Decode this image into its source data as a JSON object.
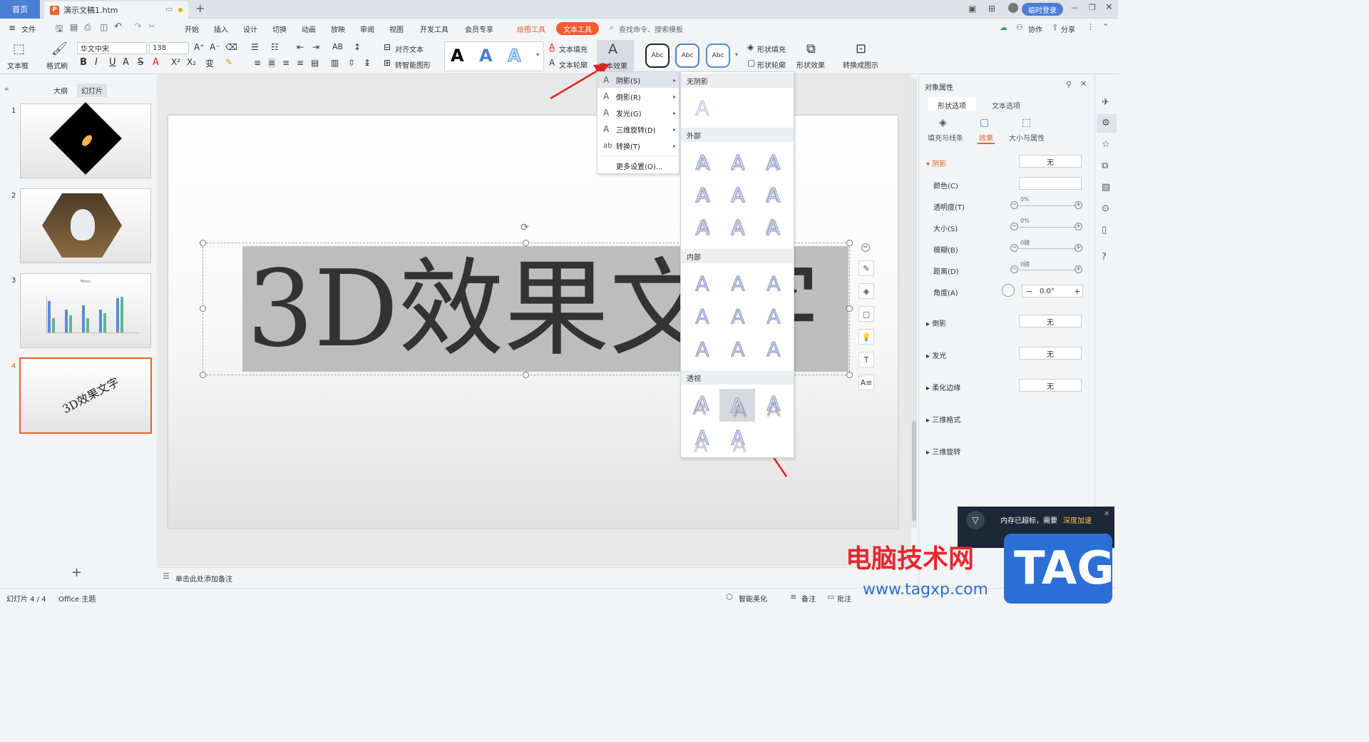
{
  "tabs": {
    "home": "首页",
    "doc_title": "演示文稿1.htm",
    "login": "临时登录"
  },
  "menu": {
    "file": "文件",
    "items": [
      "开始",
      "插入",
      "设计",
      "切换",
      "动画",
      "放映",
      "审阅",
      "视图",
      "开发工具",
      "会员专享"
    ],
    "drawing_tools": "绘图工具",
    "text_tools": "文本工具",
    "search": "查找命令、搜索模板",
    "collab": "协作",
    "share": "分享"
  },
  "ribbon": {
    "textbox": "文本框",
    "format_painter": "格式刷",
    "font": "华文中宋",
    "size": "138",
    "text_fill": "文本填充",
    "text_outline": "文本轮廓",
    "text_effect": "文本效果",
    "align_text": "对齐文本",
    "smart_shape": "转智能图形",
    "abc": [
      "Abc",
      "Abc",
      "Abc"
    ],
    "shape_fill": "形状填充",
    "shape_outline": "形状轮廓",
    "shape_effect": "形状效果",
    "convert": "转换成图示",
    "styleA": "A"
  },
  "left": {
    "outline": "大纲",
    "slides": "幻灯片",
    "nums": [
      "1",
      "2",
      "3",
      "4"
    ],
    "thumb4_text": "3D效果文字",
    "thumb3_title": "Mmm"
  },
  "slide": {
    "text": "3D效果文字"
  },
  "notes": "单击此处添加备注",
  "dropdown": {
    "items": [
      {
        "label": "阴影(S)",
        "icon": "A"
      },
      {
        "label": "倒影(R)",
        "icon": "A"
      },
      {
        "label": "发光(G)",
        "icon": "A"
      },
      {
        "label": "三维旋转(D)",
        "icon": "A"
      },
      {
        "label": "转换(T)",
        "icon": "ab"
      }
    ],
    "more": "更多设置(O)..."
  },
  "submenu": {
    "none": "无阴影",
    "outer": "外部",
    "inner": "内部",
    "perspective": "透视",
    "glyph": "A"
  },
  "panel": {
    "title": "对象属性",
    "tab_shape": "形状选项",
    "tab_text": "文本选项",
    "sub_fill": "填充与线条",
    "sub_effect": "效果",
    "sub_size": "大小与属性",
    "shadow": "阴影",
    "shadow_val": "无",
    "color": "颜色(C)",
    "opacity": "透明度(T)",
    "size": "大小(S)",
    "blur": "模糊(B)",
    "distance": "距离(D)",
    "angle": "角度(A)",
    "pct1": "0%",
    "pct2": "0%",
    "pt1": "0磅",
    "pt2": "0磅",
    "angle_val": "0.0°",
    "reflection": "倒影",
    "glow": "发光",
    "soft_edge": "柔化边缘",
    "none": "无",
    "format3d": "三维格式",
    "rotate3d": "三维旋转"
  },
  "status": {
    "slide": "幻灯片 4 / 4",
    "theme": "Office 主题",
    "beautify": "智能美化",
    "notes": "备注",
    "comment": "批注"
  },
  "popup": {
    "text": "内存已超标，需要",
    "link": "深度加速"
  },
  "watermark": {
    "site": "电脑技术网",
    "url": "www.tagxp.com",
    "tag": "TAG"
  }
}
